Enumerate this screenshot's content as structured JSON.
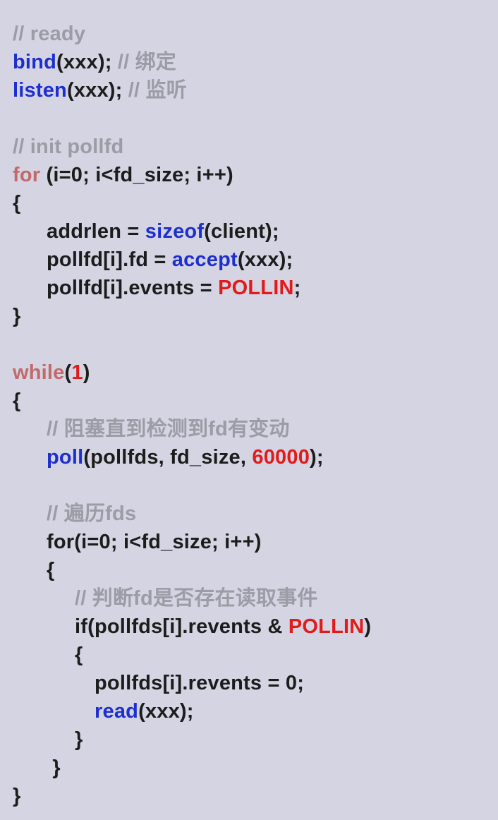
{
  "lines": [
    {
      "id": "l01",
      "indent": 0,
      "tokens": [
        {
          "t": "// ready",
          "c": "comment"
        }
      ]
    },
    {
      "id": "l02",
      "indent": 0,
      "tokens": [
        {
          "t": "bind",
          "c": "call"
        },
        {
          "t": "(xxx); ",
          "c": "plain"
        },
        {
          "t": "// 绑定",
          "c": "comment"
        }
      ]
    },
    {
      "id": "l03",
      "indent": 0,
      "tokens": [
        {
          "t": "listen",
          "c": "call"
        },
        {
          "t": "(xxx); ",
          "c": "plain"
        },
        {
          "t": "// 监听",
          "c": "comment"
        }
      ]
    },
    {
      "id": "l04",
      "indent": 0,
      "tokens": []
    },
    {
      "id": "l05",
      "indent": 0,
      "tokens": [
        {
          "t": "// init pollfd",
          "c": "comment"
        }
      ]
    },
    {
      "id": "l06",
      "indent": 0,
      "tokens": [
        {
          "t": "for",
          "c": "kw"
        },
        {
          "t": " (i=0; i<fd_size; i++)",
          "c": "plain"
        }
      ]
    },
    {
      "id": "l07",
      "indent": 0,
      "tokens": [
        {
          "t": "{",
          "c": "plain"
        }
      ]
    },
    {
      "id": "l08",
      "indent": 1,
      "tokens": [
        {
          "t": "addrlen = ",
          "c": "plain"
        },
        {
          "t": "sizeof",
          "c": "call"
        },
        {
          "t": "(client);",
          "c": "plain"
        }
      ]
    },
    {
      "id": "l09",
      "indent": 1,
      "tokens": [
        {
          "t": "pollfd[i].fd = ",
          "c": "plain"
        },
        {
          "t": "accept",
          "c": "call"
        },
        {
          "t": "(xxx);",
          "c": "plain"
        }
      ]
    },
    {
      "id": "l10",
      "indent": 1,
      "tokens": [
        {
          "t": "pollfd[i].events = ",
          "c": "plain"
        },
        {
          "t": "POLLIN",
          "c": "red"
        },
        {
          "t": ";",
          "c": "plain"
        }
      ]
    },
    {
      "id": "l11",
      "indent": 0,
      "tokens": [
        {
          "t": "}",
          "c": "plain"
        }
      ]
    },
    {
      "id": "l12",
      "indent": 0,
      "tokens": []
    },
    {
      "id": "l13",
      "indent": 0,
      "tokens": [
        {
          "t": "while",
          "c": "kw"
        },
        {
          "t": "(",
          "c": "plain"
        },
        {
          "t": "1",
          "c": "red"
        },
        {
          "t": ")",
          "c": "plain"
        }
      ]
    },
    {
      "id": "l14",
      "indent": 0,
      "tokens": [
        {
          "t": "{",
          "c": "plain"
        }
      ]
    },
    {
      "id": "l15",
      "indent": 1,
      "tokens": [
        {
          "t": "// 阻塞直到检测到fd有变动",
          "c": "comment"
        }
      ]
    },
    {
      "id": "l16",
      "indent": 1,
      "tokens": [
        {
          "t": "poll",
          "c": "call"
        },
        {
          "t": "(pollfds, fd_size, ",
          "c": "plain"
        },
        {
          "t": "60000",
          "c": "red"
        },
        {
          "t": ");",
          "c": "plain"
        }
      ]
    },
    {
      "id": "l17",
      "indent": 0,
      "tokens": []
    },
    {
      "id": "l18",
      "indent": 1,
      "tokens": [
        {
          "t": "// 遍历fds",
          "c": "comment"
        }
      ]
    },
    {
      "id": "l19",
      "indent": 1,
      "tokens": [
        {
          "t": "for(i=0; i<fd_size; i++)",
          "c": "plain"
        }
      ]
    },
    {
      "id": "l20",
      "indent": 1,
      "tokens": [
        {
          "t": "{",
          "c": "plain"
        }
      ]
    },
    {
      "id": "l21",
      "indent": 2,
      "tokens": [
        {
          "t": "// 判断fd是否存在读取事件",
          "c": "comment"
        }
      ]
    },
    {
      "id": "l22",
      "indent": 2,
      "tokens": [
        {
          "t": "if(pollfds[i].revents & ",
          "c": "plain"
        },
        {
          "t": "POLLIN",
          "c": "red"
        },
        {
          "t": ")",
          "c": "plain"
        }
      ]
    },
    {
      "id": "l23",
      "indent": 2,
      "tokens": [
        {
          "t": "{",
          "c": "plain"
        }
      ]
    },
    {
      "id": "l24",
      "indent": 3,
      "tokens": [
        {
          "t": "pollfds[i].revents = 0;",
          "c": "plain"
        }
      ]
    },
    {
      "id": "l25",
      "indent": 3,
      "tokens": [
        {
          "t": "read",
          "c": "call"
        },
        {
          "t": "(xxx);",
          "c": "plain"
        }
      ]
    },
    {
      "id": "l26",
      "indent": 2,
      "tokens": [
        {
          "t": "}",
          "c": "plain"
        }
      ]
    },
    {
      "id": "l27",
      "indent": 1,
      "tokens": [
        {
          "t": " }",
          "c": "plain"
        }
      ]
    },
    {
      "id": "l28",
      "indent": 0,
      "tokens": [
        {
          "t": "}",
          "c": "plain"
        }
      ]
    }
  ],
  "colors": {
    "background": "#d4d4e3",
    "comment": "#9c9ca6",
    "call": "#1e2fd0",
    "keyword": "#c26a6a",
    "constant": "#e21a1a",
    "plain": "#1c1c1c"
  }
}
